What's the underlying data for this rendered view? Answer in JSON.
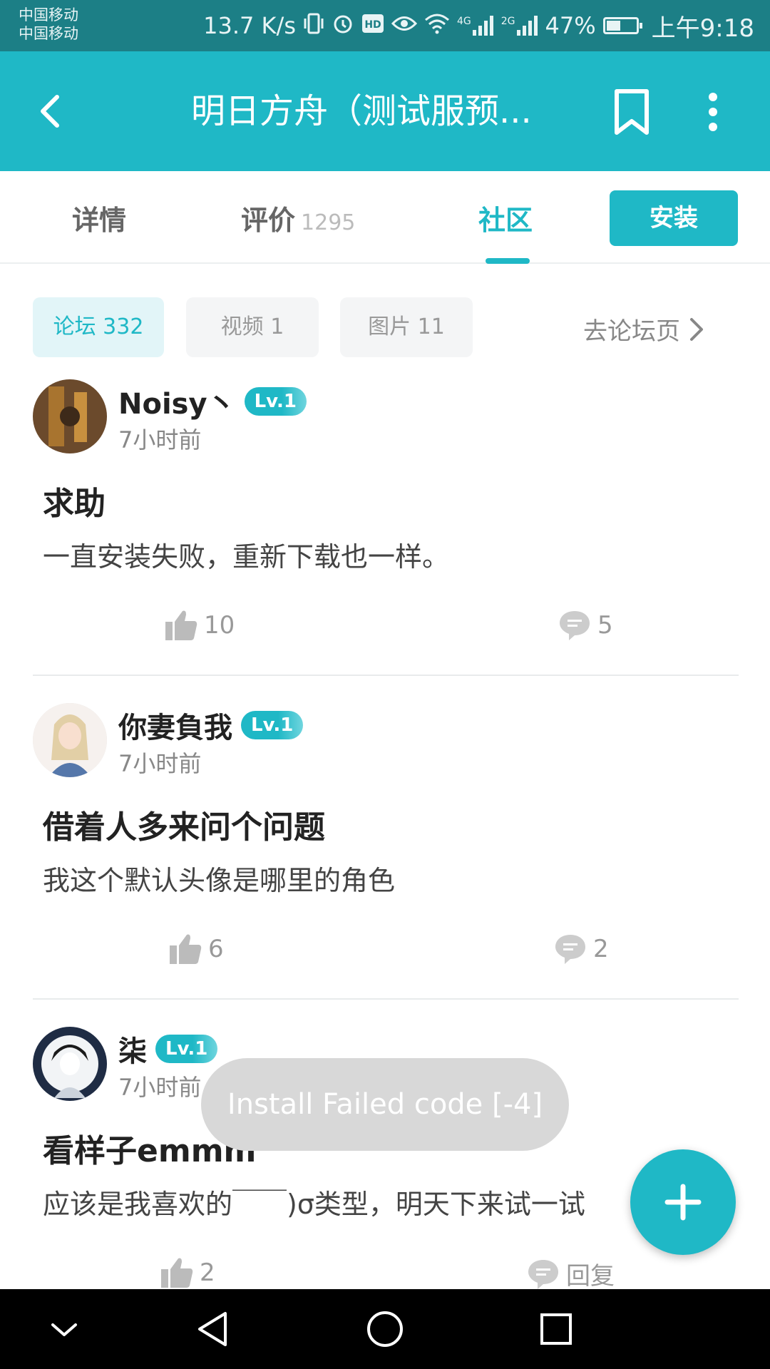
{
  "status_bar": {
    "carrier_1": "中国移动",
    "carrier_2": "中国移动",
    "speed": "13.7 K/s",
    "net_1": "4G",
    "net_2": "2G",
    "battery": "47%",
    "time": "上午9:18"
  },
  "app_bar": {
    "title": "明日方舟（测试服预..."
  },
  "tabs": [
    {
      "label": "详情"
    },
    {
      "label": "评价",
      "count": "1295"
    },
    {
      "label": "社区"
    }
  ],
  "install_label": "安装",
  "chips": [
    {
      "label": "论坛",
      "count": "332"
    },
    {
      "label": "视频",
      "count": "1"
    },
    {
      "label": "图片",
      "count": "11"
    }
  ],
  "forum_link": "去论坛页",
  "posts": [
    {
      "username": "Noisy丶",
      "level": "Lv.1",
      "time": "7小时前",
      "title": "求助",
      "body": "一直安装失败，重新下载也一样。",
      "likes": "10",
      "replies": "5"
    },
    {
      "username": "你妻負我",
      "level": "Lv.1",
      "time": "7小时前",
      "title": "借着人多来问个问题",
      "body": "我这个默认头像是哪里的角色",
      "likes": "6",
      "replies": "2"
    },
    {
      "username": "柒",
      "level": "Lv.1",
      "time": "7小时前",
      "title": "看样子emmm",
      "body": "应该是我喜欢的￣￣)σ类型，明天下来试一试",
      "likes": "2",
      "replies": "回复"
    }
  ],
  "toast": "Install Failed code [-4]",
  "colors": {
    "accent": "#1fb8c6",
    "status_bar": "#1c7f86"
  },
  "icons": [
    "back-icon",
    "bookmark-icon",
    "more-vert-icon",
    "chevron-right-icon",
    "thumbs-up-icon",
    "comment-icon",
    "plus-icon",
    "nav-down-icon",
    "nav-back-icon",
    "nav-home-icon",
    "nav-recents-icon"
  ]
}
